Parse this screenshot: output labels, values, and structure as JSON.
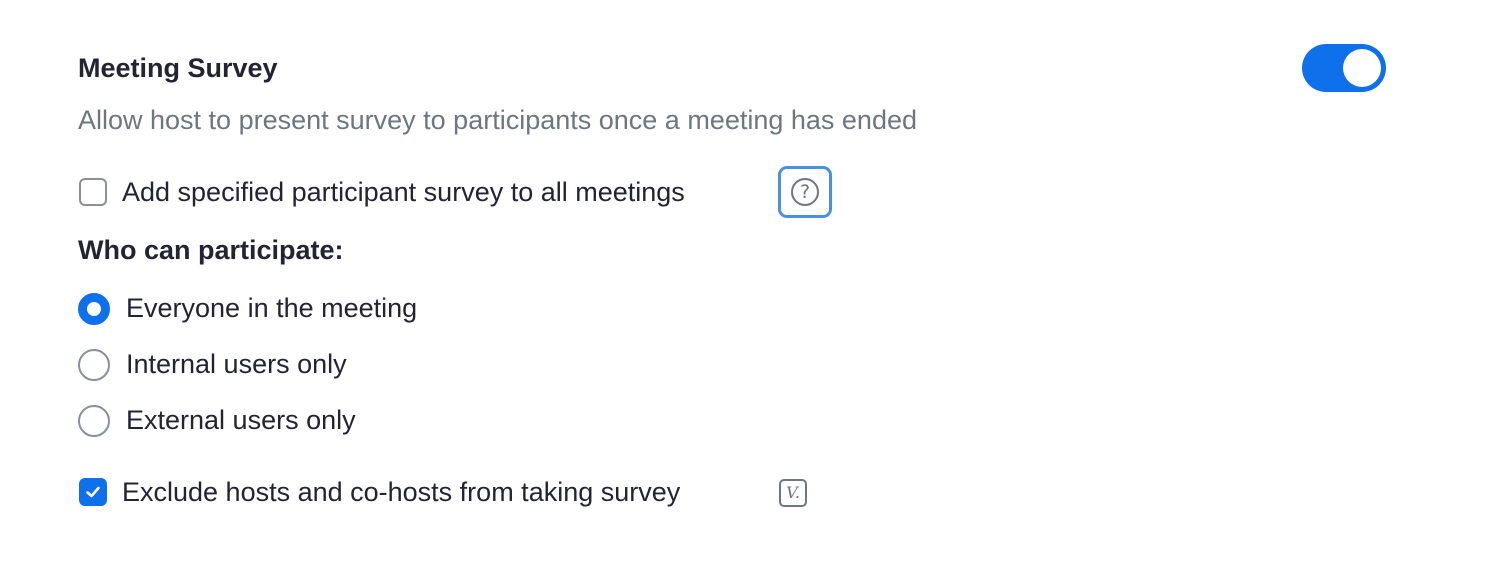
{
  "setting": {
    "title": "Meeting Survey",
    "description": "Allow host to present survey to participants once a meeting has ended",
    "enabled": true,
    "accent_color": "#0e71eb"
  },
  "add_survey": {
    "label": "Add specified participant survey to all meetings",
    "checked": false,
    "help_icon": "?"
  },
  "who_can_participate": {
    "heading": "Who can participate:",
    "options": [
      {
        "label": "Everyone in the meeting",
        "selected": true
      },
      {
        "label": "Internal users only",
        "selected": false
      },
      {
        "label": "External users only",
        "selected": false
      }
    ]
  },
  "exclude_hosts": {
    "label": "Exclude hosts and co-hosts from taking survey",
    "checked": true,
    "badge": "V."
  }
}
